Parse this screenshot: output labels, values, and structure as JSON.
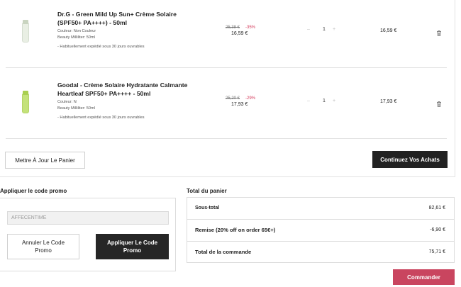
{
  "cart": {
    "items": [
      {
        "name": "Dr.G - Green Mild Up Sun+ Crème Solaire (SPF50+ PA++++) - 50ml",
        "color_line": "Couleur: Non Couleur",
        "volume_line": "Beauty Milliliter: 50ml",
        "shipping": "- Habituellement expédié sous 30 jours ouvrables",
        "old_price": "25,38 €",
        "discount": "-35%",
        "price": "16,59 €",
        "quantity": "1",
        "line_total": "16,59 €",
        "thumb_tube_color": "#e9efe4",
        "thumb_cap_color": "#c9d4c0"
      },
      {
        "name": "Goodal - Crème Solaire Hydratante Calmante Heartleaf SPF50+ PA++++ - 50ml",
        "color_line": "Couleur: N",
        "volume_line": "Beauty Milliliter: 50ml",
        "shipping": "- Habituellement expédié sous 30 jours ouvrables",
        "old_price": "25,20 €",
        "discount": "-29%",
        "price": "17,93 €",
        "quantity": "1",
        "line_total": "17,93 €",
        "thumb_tube_color": "#c4e27a",
        "thumb_cap_color": "#a9cf4f"
      }
    ],
    "qty_minus": "–",
    "qty_plus": "+",
    "update_button": "Mettre À Jour Le Panier",
    "continue_button": "Continuez Vos Achats"
  },
  "promo": {
    "title": "Appliquer le code promo",
    "input_placeholder": "AFFECENTIME",
    "cancel_button": "Annuler Le Code Promo",
    "apply_button": "Appliquer Le Code Promo"
  },
  "totals": {
    "title": "Total du panier",
    "subtotal_label": "Sous-total",
    "subtotal_value": "82,61 €",
    "discount_label": "Remise (20% off on order 65€+)",
    "discount_value": "-6,90 €",
    "total_label": "Total de la commande",
    "total_value": "75,71 €"
  },
  "order_button": "Commander",
  "colors": {
    "accent": "#c9455f",
    "dark_button": "#222222",
    "discount_text": "#d43c5c"
  }
}
